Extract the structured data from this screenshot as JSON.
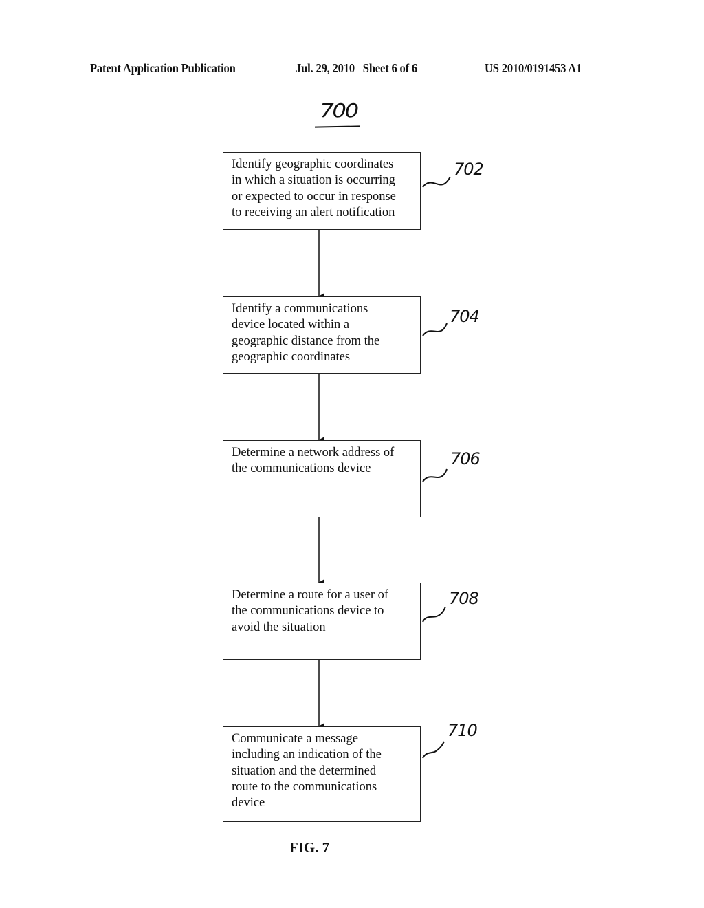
{
  "header": {
    "publication_type": "Patent Application Publication",
    "date_sheet": "Jul. 29, 2010   Sheet 6 of 6",
    "publication_number": "US 2010/0191453 A1"
  },
  "figure": {
    "number": "700",
    "caption": "FIG. 7"
  },
  "steps": [
    {
      "ref": "702",
      "lines": [
        "Identify geographic coordinates",
        "in which a situation is occurring",
        "or expected to occur in response",
        "to receiving an alert notification"
      ]
    },
    {
      "ref": "704",
      "lines": [
        "Identify a communications",
        "device located within a",
        "geographic distance from the",
        "geographic coordinates"
      ]
    },
    {
      "ref": "706",
      "lines": [
        "Determine a network address of",
        "the communications device"
      ]
    },
    {
      "ref": "708",
      "lines": [
        "Determine a route for a user of",
        "the communications device to",
        "avoid the situation"
      ]
    },
    {
      "ref": "710",
      "lines": [
        "Communicate a message",
        "including an indication of the",
        "situation and the determined",
        "route to the communications",
        "device"
      ]
    }
  ]
}
